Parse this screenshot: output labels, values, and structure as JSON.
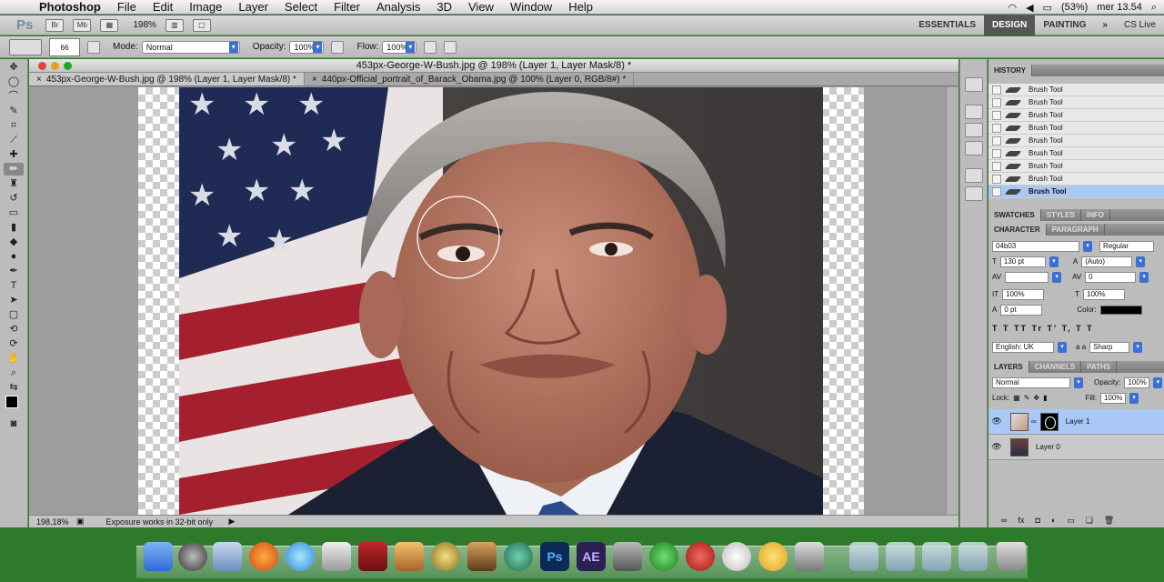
{
  "menubar": {
    "app": "Photoshop",
    "items": [
      "File",
      "Edit",
      "Image",
      "Layer",
      "Select",
      "Filter",
      "Analysis",
      "3D",
      "View",
      "Window",
      "Help"
    ],
    "battery": "(53%)",
    "clock": "mer 13.54"
  },
  "appbar": {
    "logo": "Ps",
    "zoom": "198%",
    "workspaces": [
      "ESSENTIALS",
      "DESIGN",
      "PAINTING"
    ],
    "active_workspace": "DESIGN",
    "cs_live": "CS Live"
  },
  "options": {
    "brush_size": "66",
    "mode_label": "Mode:",
    "mode_value": "Normal",
    "opacity_label": "Opacity:",
    "opacity_value": "100%",
    "flow_label": "Flow:",
    "flow_value": "100%"
  },
  "document": {
    "window_title": "453px-George-W-Bush.jpg @ 198% (Layer 1, Layer Mask/8) *",
    "tabs": [
      {
        "label": "453px-George-W-Bush.jpg @ 198% (Layer 1, Layer Mask/8) *",
        "active": true
      },
      {
        "label": "440px-Official_portrait_of_Barack_Obama.jpg @ 100% (Layer 0, RGB/8#) *",
        "active": false
      }
    ],
    "status_zoom": "198,18%",
    "status_message": "Exposure works in 32-bit only"
  },
  "history": {
    "tabs": [
      "HISTORY"
    ],
    "items": [
      "Brush Tool",
      "Brush Tool",
      "Brush Tool",
      "Brush Tool",
      "Brush Tool",
      "Brush Tool",
      "Brush Tool",
      "Brush Tool",
      "Brush Tool"
    ]
  },
  "swatches": {
    "tabs": [
      "SWATCHES",
      "STYLES",
      "INFO"
    ]
  },
  "character": {
    "tabs": [
      "CHARACTER",
      "PARAGRAPH"
    ],
    "font_family": "04b03",
    "font_style": "Regular",
    "font_size": "130 pt",
    "leading": "(Auto)",
    "kerning": "",
    "tracking": "0",
    "vscale": "100%",
    "hscale": "100%",
    "baseline": "0 pt",
    "color_label": "Color:",
    "style_buttons": "T T TT Tr T' T, T T",
    "language": "English: UK",
    "aa_label": "a a",
    "antialias": "Sharp"
  },
  "layers": {
    "tabs": [
      "LAYERS",
      "CHANNELS",
      "PATHS"
    ],
    "blend": "Normal",
    "opacity_label": "Opacity:",
    "opacity": "100%",
    "lock_label": "Lock:",
    "fill_label": "Fill:",
    "fill": "100%",
    "items": [
      {
        "name": "Layer 1",
        "selected": true
      },
      {
        "name": "Layer 0",
        "selected": false
      }
    ]
  }
}
